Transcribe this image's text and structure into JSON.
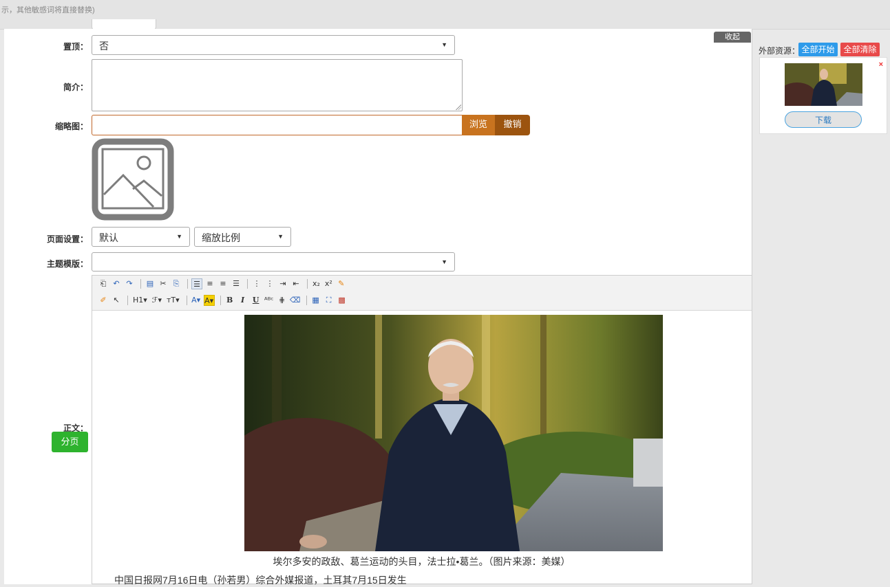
{
  "top": {
    "notice": "示，其他敏感词将直接替换)"
  },
  "panel": {
    "collapse_label": "收起"
  },
  "form": {
    "pin": {
      "label": "置顶：",
      "value": "否"
    },
    "summary": {
      "label": "简介：",
      "value": ""
    },
    "thumbnail": {
      "label": "缩略图：",
      "value": "",
      "browse_label": "浏览",
      "undo_label": "撤销"
    },
    "page_settings": {
      "label": "页面设置：",
      "layout_value": "默认",
      "scale_value": "缩放比例"
    },
    "theme": {
      "label": "主题模版：",
      "value": ""
    },
    "content": {
      "label": "正文：",
      "pages_button": "分页"
    }
  },
  "editor": {
    "toolbar_row1": [
      {
        "name": "source-icon",
        "glyph": "⎗"
      },
      {
        "name": "undo-icon",
        "glyph": "↶"
      },
      {
        "name": "redo-icon",
        "glyph": "↷"
      },
      {
        "sep": true
      },
      {
        "name": "paste-text-icon",
        "glyph": "▤"
      },
      {
        "name": "cut-icon",
        "glyph": "✂"
      },
      {
        "name": "copy-icon",
        "glyph": "⎘"
      },
      {
        "sep": true
      },
      {
        "name": "align-left-icon",
        "glyph": "☰"
      },
      {
        "name": "align-center-icon",
        "glyph": "≡"
      },
      {
        "name": "align-right-icon",
        "glyph": "≡"
      },
      {
        "name": "align-justify-icon",
        "glyph": "☰"
      },
      {
        "sep": true
      },
      {
        "name": "ordered-list-icon",
        "glyph": "⋮"
      },
      {
        "name": "unordered-list-icon",
        "glyph": "⋮"
      },
      {
        "name": "indent-icon",
        "glyph": "⇥"
      },
      {
        "name": "outdent-icon",
        "glyph": "⇤"
      },
      {
        "sep": true
      },
      {
        "name": "subscript-icon",
        "glyph": "x₂"
      },
      {
        "name": "superscript-icon",
        "glyph": "x²"
      },
      {
        "name": "clear-format-icon",
        "glyph": "✎"
      }
    ],
    "toolbar_row2": [
      {
        "name": "format-painter-icon",
        "glyph": "✐"
      },
      {
        "name": "select-icon",
        "glyph": "↖"
      },
      {
        "sep": true
      },
      {
        "name": "heading-dropdown",
        "glyph": "H1▾"
      },
      {
        "name": "font-family-dropdown",
        "glyph": "ℱ▾"
      },
      {
        "name": "font-size-dropdown",
        "glyph": "тT▾"
      },
      {
        "sep": true
      },
      {
        "name": "font-color-dropdown",
        "glyph": "A▾"
      },
      {
        "name": "highlight-color-dropdown",
        "glyph": "A▾"
      },
      {
        "sep": true
      },
      {
        "name": "bold-icon",
        "glyph": "B"
      },
      {
        "name": "italic-icon",
        "glyph": "I"
      },
      {
        "name": "underline-icon",
        "glyph": "U"
      },
      {
        "name": "strikethrough-icon",
        "glyph": "ᴬᴮᶜ"
      },
      {
        "name": "horizontal-rule-icon",
        "glyph": "⋕"
      },
      {
        "name": "eraser-icon",
        "glyph": "⌫"
      },
      {
        "sep": true
      },
      {
        "name": "table-icon",
        "glyph": "▦"
      },
      {
        "name": "fullscreen-icon",
        "glyph": "⛶"
      },
      {
        "name": "image-icon",
        "glyph": "▩"
      }
    ],
    "caption": "埃尔多安的政敌、葛兰运动的头目，法士拉•葛兰。（图片来源：美媒）",
    "body_text": "中国日报网7月16日电（孙若男）综合外媒报道，土耳其7月15日发生"
  },
  "external": {
    "title": "外部资源：",
    "start_all": "全部开始",
    "clear_all": "全部清除",
    "download_label": "下载",
    "close_glyph": "×"
  },
  "colors": {
    "accent_orange": "#c8731f",
    "accent_orange_dark": "#9c540f",
    "green": "#2eb32e",
    "blue": "#2e9bea",
    "red": "#e84a4a"
  }
}
